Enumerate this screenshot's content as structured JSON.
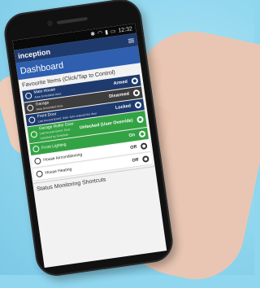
{
  "status_bar": {
    "time": "12:32"
  },
  "app": {
    "brand": "inception"
  },
  "header": {
    "title": "Dashboard"
  },
  "favourites": {
    "title": "Favourite Items (Click/Tap to Control)",
    "items": [
      {
        "name": "Main House",
        "sub": "Area Scheduled Area",
        "state": "Armed"
      },
      {
        "name": "Garage",
        "sub": "Area Scheduled Area",
        "state": "Disarmed"
      },
      {
        "name": "Front Door",
        "sub": "Last Access Event: User John entered the door",
        "state": "Locked"
      },
      {
        "name": "Garage Roller Door",
        "sub": "Last Access Event: Door Unlocked by Schedule",
        "state": "Unlocked (User Override)"
      },
      {
        "name": "Front Lighting",
        "sub": "",
        "state": "On"
      },
      {
        "name": "House Airconditioning",
        "sub": "",
        "state": "Off"
      },
      {
        "name": "House Heating",
        "sub": "",
        "state": "Off"
      }
    ]
  },
  "status_monitoring": {
    "title": "Status Monitoring Shortcuts"
  },
  "colors": {
    "header": "#1f3b6e",
    "title_bar": "#2f5fae",
    "active": "#33a244",
    "inactive": "#3d3d3d"
  }
}
